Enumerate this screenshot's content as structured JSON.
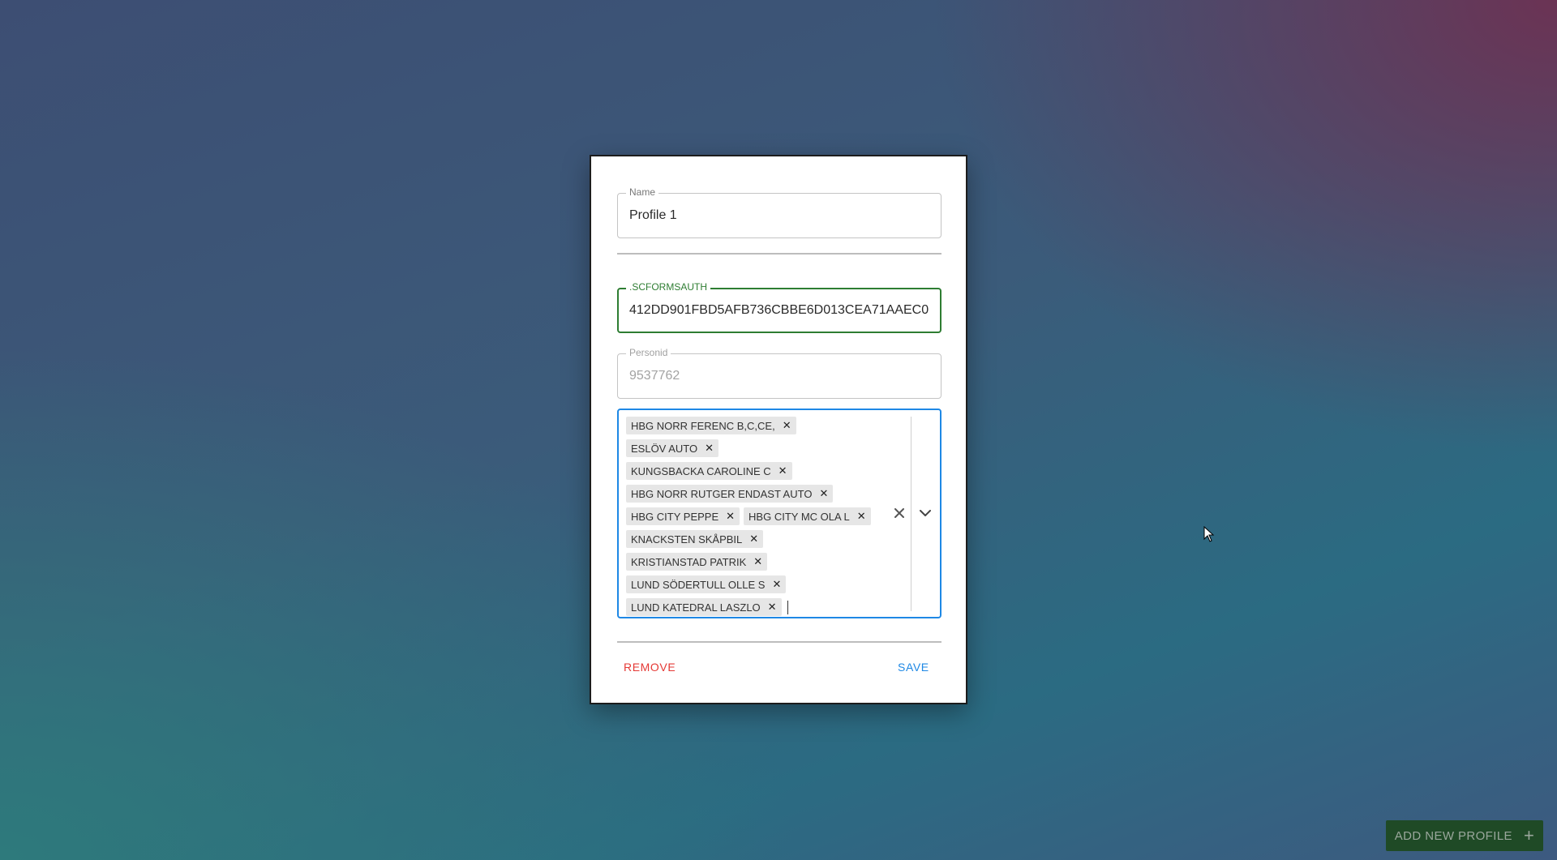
{
  "form": {
    "name_label": "Name",
    "name_value": "Profile 1",
    "auth_label": ".SCFORMSAUTH",
    "auth_value": "412DD901FBD5AFB736CBBE6D013CEA71AAEC0",
    "person_label": "Personid",
    "person_value": "9537762",
    "tags": [
      "HBG NORR FERENC B,C,CE,",
      "ESLÖV AUTO",
      "KUNGSBACKA CAROLINE C",
      "HBG NORR RUTGER ENDAST AUTO",
      "HBG CITY PEPPE",
      "HBG CITY MC OLA L",
      "KNACKSTEN SKÅPBIL",
      "KRISTIANSTAD PATRIK",
      "LUND SÖDERTULL OLLE S",
      "LUND KATEDRAL LASZLO"
    ],
    "remove_label": "REMOVE",
    "save_label": "SAVE"
  },
  "fab": {
    "label": "ADD NEW PROFILE",
    "icon": "plus-icon"
  },
  "colors": {
    "focus_green": "#2e7d32",
    "focus_blue": "#1e88e5",
    "danger_red": "#e53935",
    "fab_bg": "#1f4a26"
  }
}
